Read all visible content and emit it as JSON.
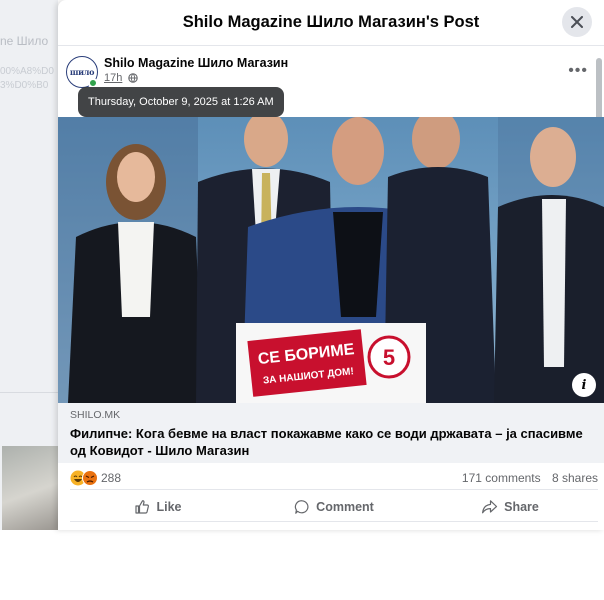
{
  "background": {
    "line1": "ne Шило",
    "line2": "00%A8%D0",
    "line3": "3%D0%B0"
  },
  "modal": {
    "title": "Shilo Magazine Шило Магазин's Post"
  },
  "post": {
    "page_name": "Shilo Magazine Шило Магазин",
    "avatar_text": "шило",
    "time": "17h",
    "time_tooltip": "Thursday, October 9, 2025 at 1:26 AM",
    "podium_sign": {
      "line1": "СЕ БОРИМЕ",
      "line2": "ЗА НАШИОТ ДОМ!",
      "number": "5"
    },
    "link": {
      "domain": "SHILO.MK",
      "title": "Филипче: Кога бевме на власт покажавме како се води државата – ја спасивме од Ковидот - Шило Магазин"
    },
    "reactions": {
      "count": "288",
      "icons": [
        "haha-icon",
        "angry-icon"
      ]
    },
    "comments": "171 comments",
    "shares": "8 shares"
  },
  "actions": {
    "like": "Like",
    "comment": "Comment",
    "share": "Share"
  },
  "colors": {
    "accent_red": "#c8102e",
    "text_secondary": "#65676b",
    "online_green": "#31a24c"
  }
}
